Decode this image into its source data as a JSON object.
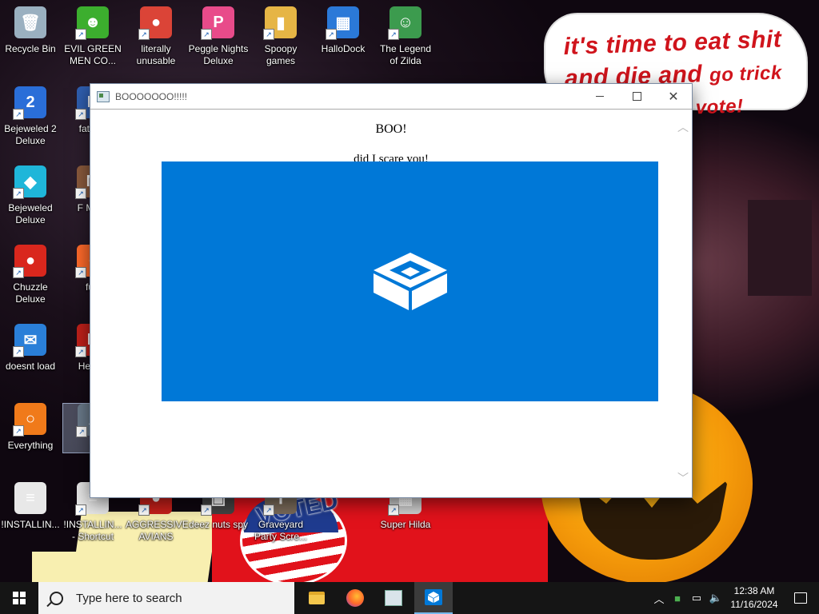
{
  "wallpaper": {
    "speech_balloon": {
      "line1": "it's time to eat shit",
      "line2a": "and die and",
      "line2b": "go trick",
      "line3": "d vote!"
    },
    "sticker_text": "VOTED"
  },
  "desktop_icons": [
    {
      "label": "Recycle Bin",
      "icon": "recycle-bin-icon",
      "color": "#9ab0c0",
      "glyph": "🗑"
    },
    {
      "label": "EVIL GREEN MEN CO...",
      "icon": "green-men-icon",
      "color": "#3cae2e",
      "glyph": "☻"
    },
    {
      "label": "literally unusable",
      "icon": "chrome-icon",
      "color": "#db4437",
      "glyph": "●"
    },
    {
      "label": "Peggle Nights Deluxe",
      "icon": "peggle-icon",
      "color": "#e84b8a",
      "glyph": "P"
    },
    {
      "label": "Spoopy games",
      "icon": "folder-icon",
      "color": "#e6b545",
      "glyph": "▮"
    },
    {
      "label": "HalloDock",
      "icon": "windows-shield-icon",
      "color": "#2b79d8",
      "glyph": "▦"
    },
    {
      "label": "The Legend of Zilda",
      "icon": "zilda-icon",
      "color": "#3c9b4e",
      "glyph": "☺"
    },
    {
      "label": "Bejeweled 2 Deluxe",
      "icon": "bejeweled2-icon",
      "color": "#2a6ed8",
      "glyph": "2"
    },
    {
      "label": "fat like",
      "icon": "app-icon",
      "color": "#2f5fb0",
      "glyph": "N"
    },
    {
      "label": "Bejeweled Deluxe",
      "icon": "gem-icon",
      "color": "#1fb6d9",
      "glyph": "◆"
    },
    {
      "label": "F MON",
      "icon": "monster-icon",
      "color": "#8a5a3c",
      "glyph": "M"
    },
    {
      "label": "Chuzzle Deluxe",
      "icon": "chuzzle-icon",
      "color": "#d9271d",
      "glyph": "●"
    },
    {
      "label": "furr",
      "icon": "firefox-icon",
      "color": "#ff6a2a",
      "glyph": "●"
    },
    {
      "label": "doesnt load",
      "icon": "thunderbird-icon",
      "color": "#2a7fd8",
      "glyph": "✉"
    },
    {
      "label": "He We",
      "icon": "app-red-icon",
      "color": "#c0201a",
      "glyph": "H"
    },
    {
      "label": "Everything",
      "icon": "everything-search-icon",
      "color": "#f07a1a",
      "glyph": "○"
    },
    {
      "label": "is",
      "icon": "app-gray-icon",
      "color": "#6a7a8a",
      "glyph": "▲"
    },
    {
      "label": "!INSTALLIN...",
      "icon": "text-file-icon",
      "color": "#e8e8e8",
      "glyph": "≡"
    },
    {
      "label": "!INSTALLIN... - Shortcut",
      "icon": "text-file-shortcut-icon",
      "color": "#e8e8e8",
      "glyph": "≡"
    },
    {
      "label": "AGGRESSIVE AVIANS",
      "icon": "angry-bird-icon",
      "color": "#c8201a",
      "glyph": "●"
    },
    {
      "label": "deez nuts spy",
      "icon": "spy-icon",
      "color": "#444444",
      "glyph": "▣"
    },
    {
      "label": "Graveyard Party Scre...",
      "icon": "graveyard-icon",
      "color": "#7a6a5a",
      "glyph": "✝"
    },
    {
      "label": "Super Hilda",
      "icon": "super-hilda-icon",
      "color": "#cfcfcf",
      "glyph": "▦"
    }
  ],
  "window": {
    "title": "BOOOOOOO!!!!!",
    "heading": "BOO!",
    "subtext": "did I scare you!",
    "panel_color": "#0078d7",
    "panel_icon": "sandbox-box-icon"
  },
  "taskbar": {
    "search_placeholder": "Type here to search",
    "apps": [
      "file-explorer-icon",
      "firefox-icon",
      "app-window-icon",
      "sandbox-icon"
    ],
    "clock_time": "12:38 AM",
    "clock_date": "11/16/2024"
  }
}
